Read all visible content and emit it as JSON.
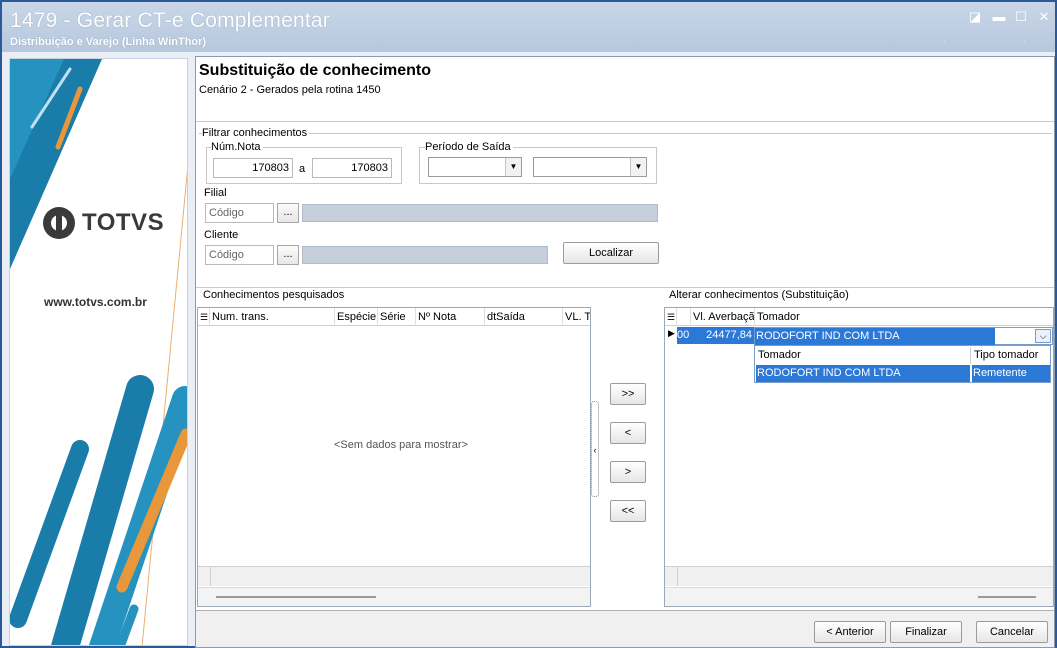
{
  "window": {
    "title": "1479 - Gerar CT-e Complementar",
    "subtitle": "Distribuição e Varejo (Linha WinThor)",
    "controls": {
      "restore": "◪",
      "minimize": "▬",
      "maximize": "☐",
      "close": "✕"
    }
  },
  "sidebar": {
    "logo_text": "TOTVS",
    "website": "www.totvs.com.br"
  },
  "page": {
    "title": "Substituição de conhecimento",
    "subtitle": "Cenário 2 - Gerados pela rotina 1450"
  },
  "filter": {
    "group_label": "Filtrar conhecimentos",
    "num_nota_label": "Núm.Nota",
    "num_nota_from": "170803",
    "num_nota_separator": "a",
    "num_nota_to": "170803",
    "periodo_label": "Período de Saída",
    "filial_label": "Filial",
    "filial_placeholder": "Código",
    "cliente_label": "Cliente",
    "cliente_placeholder": "Código",
    "lookup_label": "...",
    "search_button": "Localizar"
  },
  "searched": {
    "group_label": "Conhecimentos pesquisados",
    "columns": [
      "Num. trans.",
      "Espécie",
      "Série",
      "Nº Nota",
      "dtSaída",
      "VL. T"
    ],
    "empty_text": "<Sem dados para mostrar>"
  },
  "move_buttons": {
    "add_all": ">>",
    "remove_one": "<",
    "add_one": ">",
    "remove_all": "<<"
  },
  "altered": {
    "group_label": "Alterar conhecimentos (Substituição)",
    "columns": [
      "Vl. Averbaçã",
      "Tomador"
    ],
    "row": {
      "prefix": "00",
      "vl_averbacao": "24477,84",
      "tomador": "RODOFORT IND COM LTDA"
    },
    "dropdown": {
      "columns": [
        "Tomador",
        "Tipo tomador"
      ],
      "option": {
        "tomador": "RODOFORT IND COM LTDA",
        "tipo": "Remetente"
      }
    }
  },
  "footer": {
    "prev_button": "< Anterior",
    "finish_button": "Finalizar",
    "cancel_button": "Cancelar"
  },
  "colors": {
    "accent": "#2b78d6",
    "title_bar": "#c9d6e8",
    "logo_teal": "#1a7ca8",
    "logo_orange": "#e8973a"
  }
}
